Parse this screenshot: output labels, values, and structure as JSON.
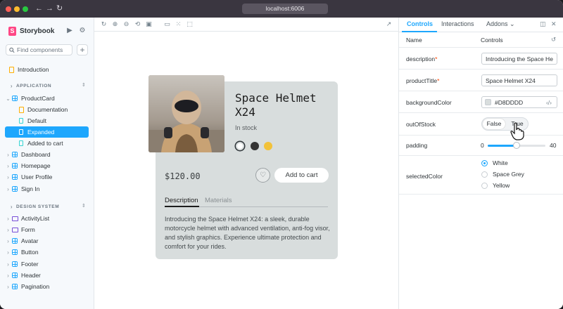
{
  "browser": {
    "url": "localhost:6006",
    "dots": [
      "#ff5f57",
      "#febc2e",
      "#28c840"
    ]
  },
  "sidebar": {
    "brand": "Storybook",
    "search_placeholder": "Find components",
    "introduction": "Introduction",
    "groups": [
      {
        "label": "APPLICATION",
        "items": [
          {
            "label": "ProductCard",
            "kind": "component",
            "expanded": true,
            "children": [
              {
                "label": "Documentation",
                "kind": "doc"
              },
              {
                "label": "Default",
                "kind": "story"
              },
              {
                "label": "Expanded",
                "kind": "story",
                "selected": true
              },
              {
                "label": "Added to cart",
                "kind": "story"
              }
            ]
          },
          {
            "label": "Dashboard",
            "kind": "component"
          },
          {
            "label": "Homepage",
            "kind": "component"
          },
          {
            "label": "User Profile",
            "kind": "component"
          },
          {
            "label": "Sign In",
            "kind": "component"
          }
        ]
      },
      {
        "label": "DESIGN SYSTEM",
        "items": [
          {
            "label": "ActivityList",
            "kind": "folder"
          },
          {
            "label": "Form",
            "kind": "folder"
          },
          {
            "label": "Avatar",
            "kind": "component"
          },
          {
            "label": "Button",
            "kind": "component"
          },
          {
            "label": "Footer",
            "kind": "component"
          },
          {
            "label": "Header",
            "kind": "component"
          },
          {
            "label": "Pagination",
            "kind": "component"
          }
        ]
      }
    ]
  },
  "product": {
    "title": "Space Helmet X24",
    "stock": "In stock",
    "price": "$120.00",
    "add_to_cart": "Add to cart",
    "tabs": [
      "Description",
      "Materials"
    ],
    "description": "Introducing the Space Helmet X24: a sleek, durable motorcycle helmet with advanced ventilation, anti-fog visor, and stylish graphics. Experience ultimate protection and comfort for your rides.",
    "swatches": [
      "#ffffff",
      "#333333",
      "#f2c23a"
    ],
    "card_color": "#D8DDDD"
  },
  "panel": {
    "tabs": {
      "controls": "Controls",
      "interactions": "Interactions",
      "addons": "Addons"
    },
    "header": {
      "name": "Name",
      "control": "Controls"
    },
    "controls": {
      "description": {
        "label": "description",
        "value": "Introducing the Space Hel..."
      },
      "productTitle": {
        "label": "productTitle",
        "value": "Space Helmet X24"
      },
      "backgroundColor": {
        "label": "backgroundColor",
        "value": "#D8DDDD"
      },
      "outOfStock": {
        "label": "outOfStock",
        "false": "False",
        "true": "True"
      },
      "padding": {
        "label": "padding",
        "min": "0",
        "max": "40",
        "value": 20
      },
      "selectedColor": {
        "label": "selectedColor",
        "options": [
          "White",
          "Space Grey",
          "Yellow"
        ],
        "selected": "White"
      }
    }
  }
}
